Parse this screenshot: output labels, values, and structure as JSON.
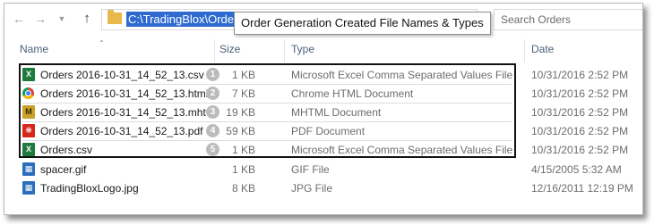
{
  "address": {
    "path": "C:\\TradingBlox\\Orders",
    "callout": "Order Generation Created File Names & Types"
  },
  "search": {
    "placeholder": "Search Orders"
  },
  "columns": {
    "name": "Name",
    "size": "Size",
    "type": "Type",
    "date": "Date"
  },
  "rows": [
    {
      "icon": "excel-csv-icon",
      "name": "Orders 2016-10-31_14_52_13.csv",
      "badge": "1",
      "size": "1 KB",
      "type": "Microsoft Excel Comma Separated Values File",
      "date": "10/31/2016 2:52 PM"
    },
    {
      "icon": "chrome-html-icon",
      "name": "Orders 2016-10-31_14_52_13.html",
      "badge": "2",
      "size": "7 KB",
      "type": "Chrome HTML Document",
      "date": "10/31/2016 2:52 PM"
    },
    {
      "icon": "mhtml-icon",
      "name": "Orders 2016-10-31_14_52_13.mht",
      "badge": "3",
      "size": "19 KB",
      "type": "MHTML Document",
      "date": "10/31/2016 2:52 PM"
    },
    {
      "icon": "pdf-icon",
      "name": "Orders 2016-10-31_14_52_13.pdf",
      "badge": "4",
      "size": "59 KB",
      "type": "PDF Document",
      "date": "10/31/2016 2:52 PM"
    },
    {
      "icon": "excel-csv-icon",
      "name": "Orders.csv",
      "badge": "5",
      "size": "1 KB",
      "type": "Microsoft Excel Comma Separated Values File",
      "date": "10/31/2016 2:52 PM"
    },
    {
      "icon": "gif-image-icon",
      "name": "spacer.gif",
      "badge": "",
      "size": "1 KB",
      "type": "GIF File",
      "date": "4/15/2005 5:32 AM"
    },
    {
      "icon": "jpg-image-icon",
      "name": "TradingBloxLogo.jpg",
      "badge": "",
      "size": "8 KB",
      "type": "JPG File",
      "date": "12/16/2011 12:19 PM"
    }
  ]
}
